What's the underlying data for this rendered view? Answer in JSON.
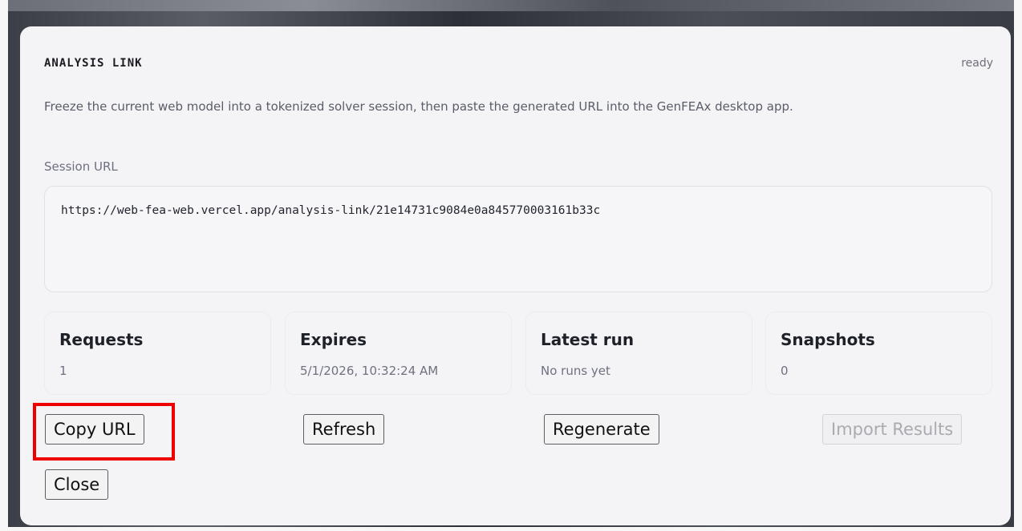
{
  "dialog": {
    "title": "ANALYSIS LINK",
    "status": "ready",
    "description": "Freeze the current web model into a tokenized solver session, then paste the generated URL into the GenFEAx desktop app.",
    "session_url_label": "Session URL",
    "session_url_value": "https://web-fea-web.vercel.app/analysis-link/21e14731c9084e0a845770003161b33c"
  },
  "stats": [
    {
      "label": "Requests",
      "value": "1"
    },
    {
      "label": "Expires",
      "value": "5/1/2026, 10:32:24 AM"
    },
    {
      "label": "Latest run",
      "value": "No runs yet"
    },
    {
      "label": "Snapshots",
      "value": "0"
    }
  ],
  "buttons": {
    "copy_url": "Copy URL",
    "refresh": "Refresh",
    "regenerate": "Regenerate",
    "import_results": "Import Results",
    "close": "Close"
  },
  "colors": {
    "highlight": "#ef0000",
    "dialog_bg": "#f4f4f6"
  }
}
